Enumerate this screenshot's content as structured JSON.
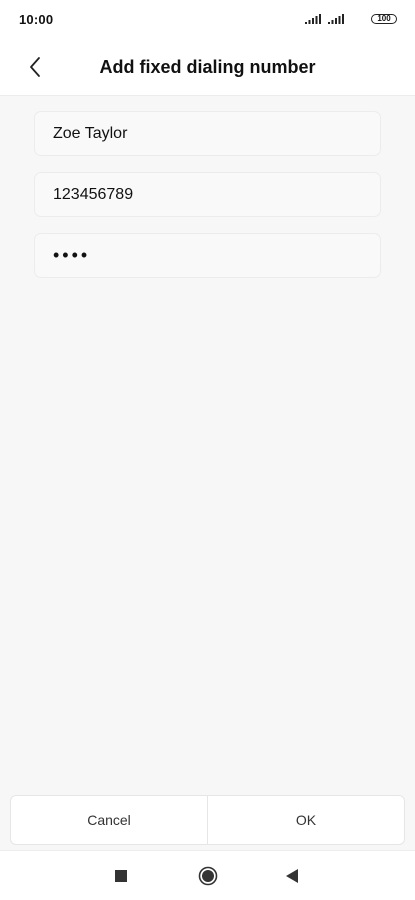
{
  "status_bar": {
    "time": "10:00",
    "battery_level": "100",
    "signal_icons": [
      "signal-icon",
      "signal-icon"
    ]
  },
  "header": {
    "title": "Add fixed dialing number",
    "back_icon": "chevron-left-icon"
  },
  "form": {
    "name_value": "Zoe Taylor",
    "number_value": "123456789",
    "pin2_value": "1234"
  },
  "actions": {
    "cancel_label": "Cancel",
    "ok_label": "OK"
  },
  "nav_bar": {
    "icons": [
      "recents-square-icon",
      "home-circle-icon",
      "back-triangle-icon"
    ]
  },
  "colors": {
    "background": "#f7f7f7",
    "surface": "#ffffff",
    "text": "#111111"
  }
}
